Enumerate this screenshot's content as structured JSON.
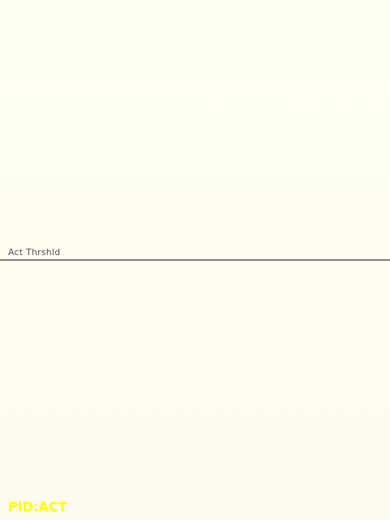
{
  "threshold": {
    "label": "Act Thrshld",
    "line_color": "#7f7f7f"
  },
  "status": {
    "pid_label": "PID:ACT",
    "color": "#ffff00"
  },
  "background": {
    "color_top": "#fffff2",
    "color_bottom": "#fdfaef"
  }
}
